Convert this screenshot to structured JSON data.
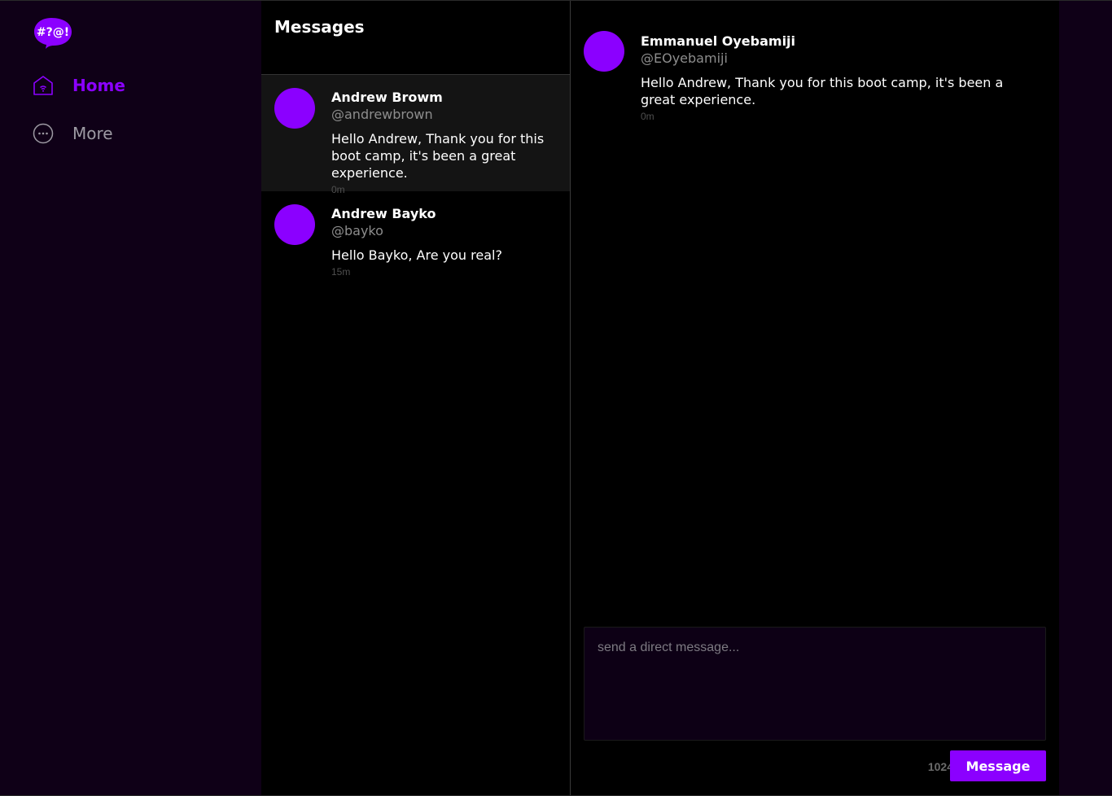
{
  "brand": {
    "logo_text": "#?@!",
    "accent_color": "#8b00ff"
  },
  "nav": {
    "items": [
      {
        "label": "Home",
        "icon": "home-icon",
        "active": true
      },
      {
        "label": "More",
        "icon": "more-icon",
        "active": false
      }
    ]
  },
  "groups": {
    "title": "Messages",
    "items": [
      {
        "name": "Andrew Browm",
        "handle": "@andrewbrown",
        "message": "Hello Andrew, Thank you for this boot camp, it's been a great experience.",
        "time": "0m",
        "active": true
      },
      {
        "name": "Andrew Bayko",
        "handle": "@bayko",
        "message": "Hello Bayko, Are you real?",
        "time": "15m",
        "active": false
      }
    ]
  },
  "conversation": {
    "messages": [
      {
        "name": "Emmanuel Oyebamiji",
        "handle": "@EOyebamiji",
        "message": "Hello Andrew, Thank you for this boot camp, it's been a great experience.",
        "time": "0m"
      }
    ],
    "composer": {
      "placeholder": "send a direct message...",
      "value": "",
      "count": "1024",
      "send_label": "Message"
    }
  }
}
